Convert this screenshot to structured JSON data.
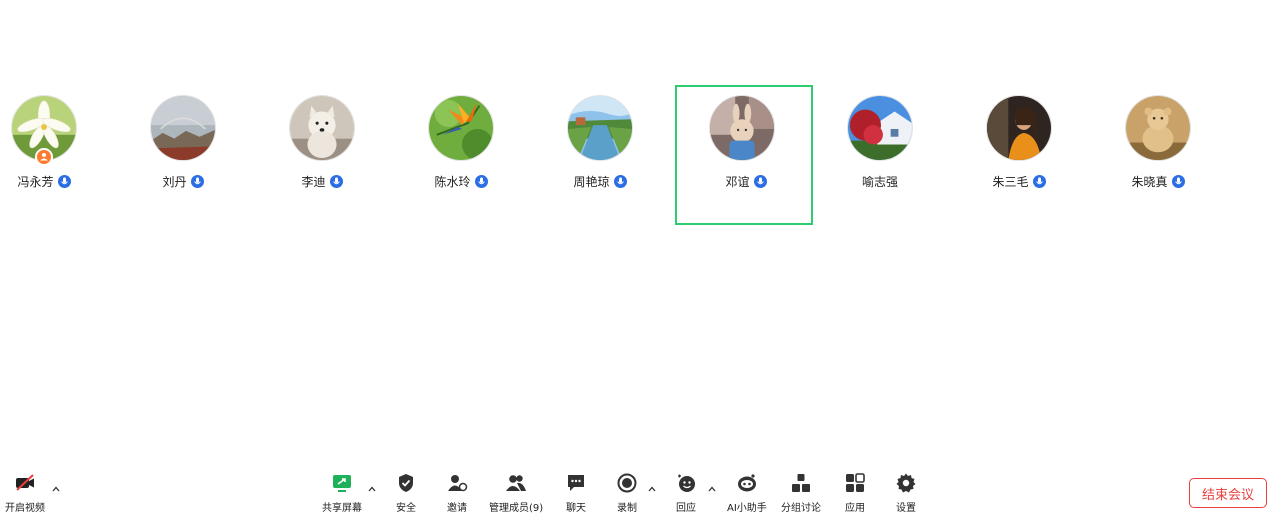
{
  "participants": [
    {
      "name": "冯永芳",
      "avatar": "lily-flower-photo",
      "mic_icon": "microphone-icon",
      "is_host": true
    },
    {
      "name": "刘丹",
      "avatar": "cloudy-sky-photo",
      "mic_icon": "microphone-icon"
    },
    {
      "name": "李迪",
      "avatar": "white-dog-photo",
      "mic_icon": "microphone-icon"
    },
    {
      "name": "陈水玲",
      "avatar": "bird-of-paradise-flower-photo",
      "mic_icon": "microphone-icon"
    },
    {
      "name": "周艳琼",
      "avatar": "river-canal-photo",
      "mic_icon": "microphone-icon"
    },
    {
      "name": "邓谊",
      "avatar": "toy-rabbit-photo",
      "mic_icon": "microphone-icon",
      "active_speaker": true
    },
    {
      "name": "喻志强",
      "avatar": "house-red-tree-photo"
    },
    {
      "name": "朱三毛",
      "avatar": "person-portrait-photo",
      "mic_icon": "microphone-icon"
    },
    {
      "name": "朱晓真",
      "avatar": "teddy-bear-photo",
      "mic_icon": "microphone-icon"
    }
  ],
  "toolbar": {
    "video": "开启视频",
    "share": "共享屏幕",
    "security": "安全",
    "invite": "邀请",
    "participants": "管理成员(9)",
    "chat": "聊天",
    "record": "录制",
    "reactions": "回应",
    "ai_assistant": "AI小助手",
    "breakout": "分组讨论",
    "apps": "应用",
    "settings": "设置",
    "end_meeting": "结束会议"
  },
  "colors": {
    "active_speaker_border": "#2ecc71",
    "mic_badge": "#2b6de5",
    "host_badge": "#ff7a2f",
    "end_button": "#e84040",
    "share_icon": "#1fb15a"
  }
}
